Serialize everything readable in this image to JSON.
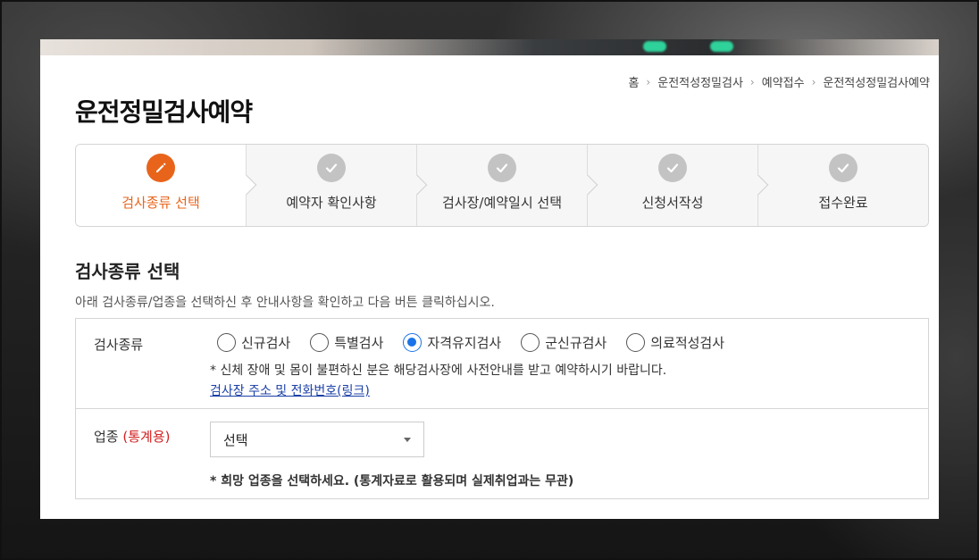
{
  "breadcrumb": [
    "홈",
    "운전적성정밀검사",
    "예약접수",
    "운전적성정밀검사예약"
  ],
  "page_title": "운전정밀검사예약",
  "steps": [
    {
      "label": "검사종류 선택",
      "active": true
    },
    {
      "label": "예약자 확인사항",
      "active": false
    },
    {
      "label": "검사장/예약일시 선택",
      "active": false
    },
    {
      "label": "신청서작성",
      "active": false
    },
    {
      "label": "접수완료",
      "active": false
    }
  ],
  "section": {
    "title": "검사종류 선택",
    "description": "아래 검사종류/업종을 선택하신 후 안내사항을 확인하고 다음 버튼 클릭하십시오."
  },
  "exam_type": {
    "label": "검사종류",
    "options": [
      "신규검사",
      "특별검사",
      "자격유지검사",
      "군신규검사",
      "의료적성검사"
    ],
    "selected": "자격유지검사",
    "note": "* 신체 장애 및 몸이 불편하신 분은 해당검사장에 사전안내를 받고 예약하시기 바랍니다.",
    "link_text": "검사장 주소 및 전화번호(링크)"
  },
  "industry": {
    "label": "업종",
    "label_suffix": "(통계용)",
    "select_value": "선택",
    "note": "* 희망 업종을 선택하세요. (통계자료로 활용되며 실제취업과는 무관)"
  },
  "colors": {
    "accent": "#e8641b",
    "radio_selected": "#1a73e8",
    "link": "#1a3fa6",
    "required_red": "#d21f1f"
  }
}
